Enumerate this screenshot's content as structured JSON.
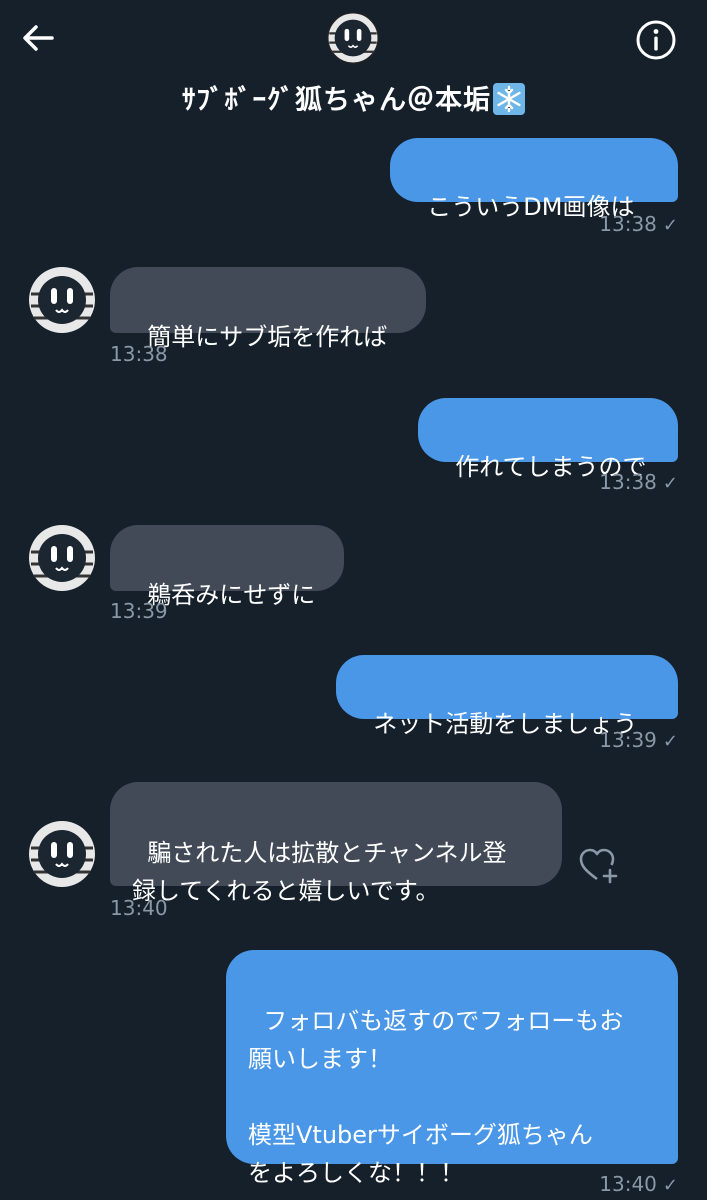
{
  "header": {
    "title": "ｻﾌﾞﾎﾞｰｸﾞ狐ちゃん＠本垢",
    "back_icon": "arrow-left-icon",
    "info_icon": "info-circle-icon",
    "title_emoji": "snowflake-icon"
  },
  "messages": [
    {
      "side": "sent",
      "text": "こういうDM画像は",
      "time": "13:38",
      "check": "✓"
    },
    {
      "side": "received",
      "text": "簡単にサブ垢を作れば",
      "time": "13:38"
    },
    {
      "side": "sent",
      "text": "作れてしまうので",
      "time": "13:38",
      "check": "✓"
    },
    {
      "side": "received",
      "text": "鵜呑みにせずに",
      "time": "13:39"
    },
    {
      "side": "sent",
      "text": "ネット活動をしましょう",
      "time": "13:39",
      "check": "✓"
    },
    {
      "side": "received",
      "text": "騙された人は拡散とチャンネル登\n録してくれると嬉しいです。",
      "time": "13:40"
    },
    {
      "side": "sent",
      "text": "フォロバも返すのでフォローもお\n願いします！\n\n模型Vtuberサイボーグ狐ちゃん\nをよろしくな！！！",
      "time": "13:40",
      "check": "✓"
    }
  ],
  "colors": {
    "background": "#15202b",
    "sent_bubble": "#4a97e8",
    "received_bubble": "#414a56",
    "timestamp": "#8b98a5"
  }
}
